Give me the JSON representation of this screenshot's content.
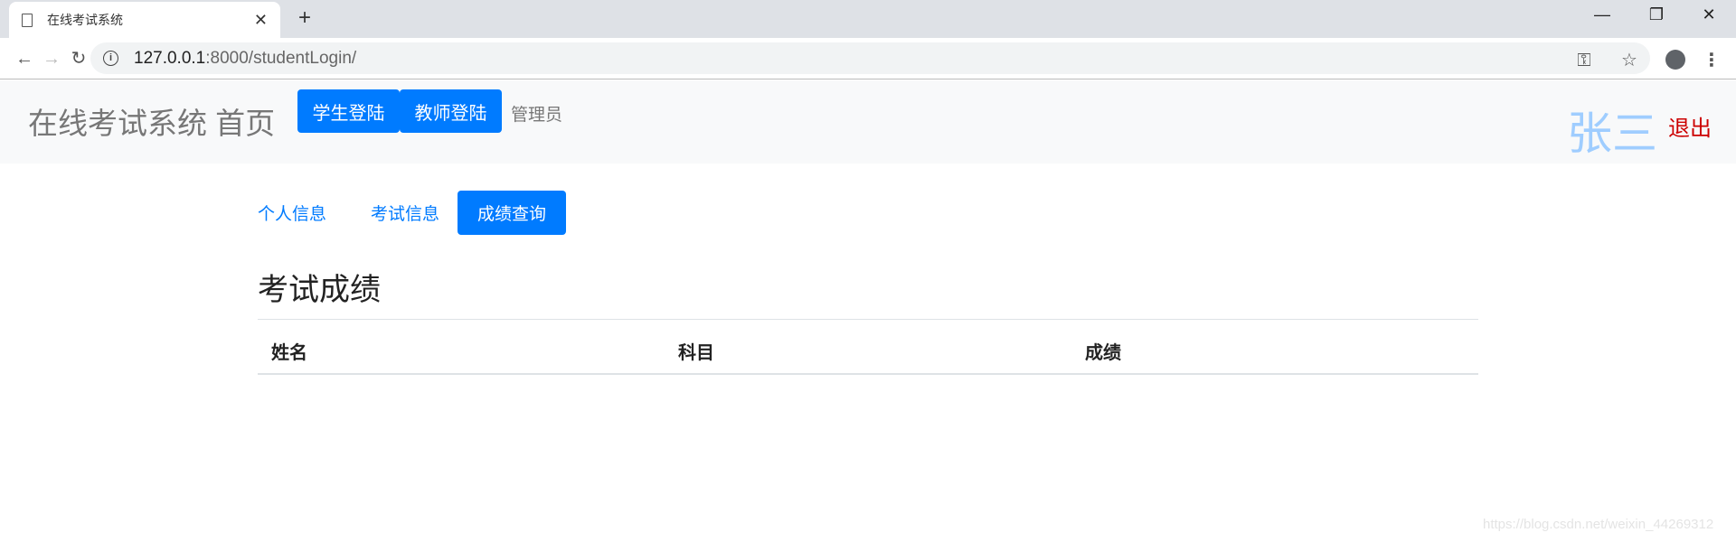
{
  "browser": {
    "tab_title": "在线考试系统",
    "url_host": "127.0.0.1",
    "url_rest": ":8000/studentLogin/"
  },
  "navbar": {
    "brand": "在线考试系统 首页",
    "student_login": "学生登陆",
    "teacher_login": "教师登陆",
    "admin": "管理员",
    "user_name": "张三",
    "logout": "退出"
  },
  "pills": [
    {
      "label": "个人信息",
      "active": false
    },
    {
      "label": "考试信息",
      "active": false
    },
    {
      "label": "成绩查询",
      "active": true
    }
  ],
  "main": {
    "heading": "考试成绩",
    "columns": [
      "姓名",
      "科目",
      "成绩"
    ],
    "rows": []
  },
  "watermark": "https://blog.csdn.net/weixin_44269312",
  "colors": {
    "primary": "#007bff",
    "logout": "#cc0000",
    "user": "#9fcdff"
  }
}
